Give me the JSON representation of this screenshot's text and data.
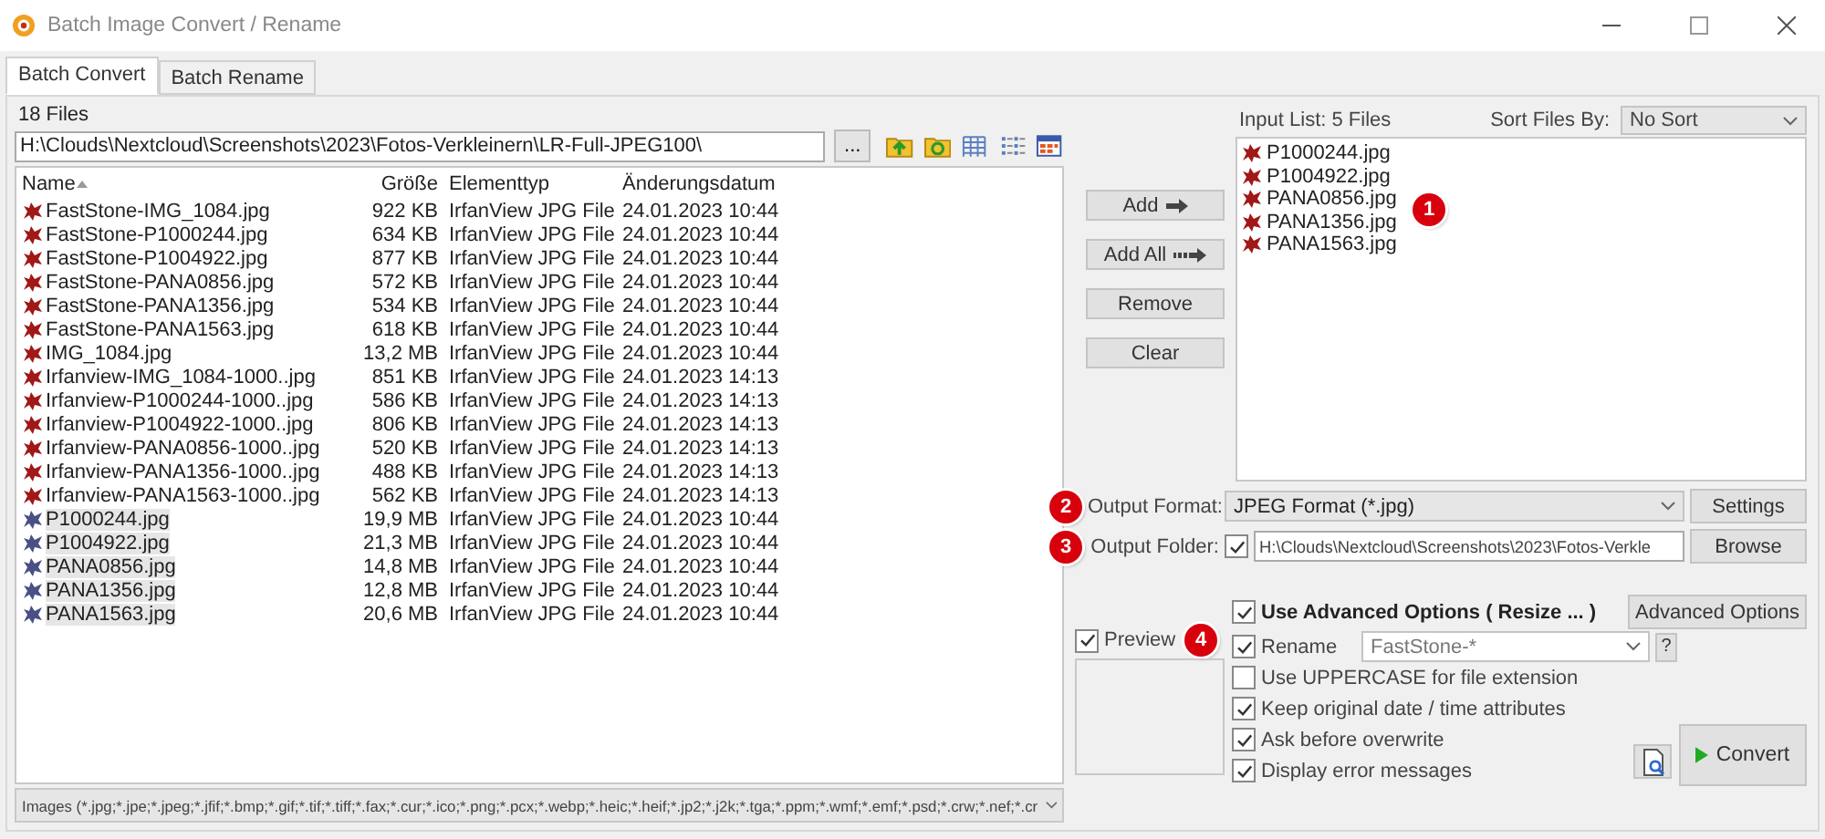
{
  "window": {
    "title": "Batch Image Convert / Rename"
  },
  "tabs": [
    {
      "label": "Batch Convert",
      "selected": true
    },
    {
      "label": "Batch Rename",
      "selected": false
    }
  ],
  "file_count": "18 Files",
  "path": {
    "value": "H:\\Clouds\\Nextcloud\\Screenshots\\2023\\Fotos-Verkleinern\\LR-Full-JPEG100\\",
    "browse": "..."
  },
  "table": {
    "columns": [
      "Name",
      "Größe",
      "Elementtyp",
      "Änderungsdatum"
    ],
    "rows": [
      {
        "name": "FastStone-IMG_1084.jpg",
        "size": "922 KB",
        "type": "IrfanView JPG File",
        "date": "24.01.2023 10:44",
        "selected": false
      },
      {
        "name": "FastStone-P1000244.jpg",
        "size": "634 KB",
        "type": "IrfanView JPG File",
        "date": "24.01.2023 10:44",
        "selected": false
      },
      {
        "name": "FastStone-P1004922.jpg",
        "size": "877 KB",
        "type": "IrfanView JPG File",
        "date": "24.01.2023 10:44",
        "selected": false
      },
      {
        "name": "FastStone-PANA0856.jpg",
        "size": "572 KB",
        "type": "IrfanView JPG File",
        "date": "24.01.2023 10:44",
        "selected": false
      },
      {
        "name": "FastStone-PANA1356.jpg",
        "size": "534 KB",
        "type": "IrfanView JPG File",
        "date": "24.01.2023 10:44",
        "selected": false
      },
      {
        "name": "FastStone-PANA1563.jpg",
        "size": "618 KB",
        "type": "IrfanView JPG File",
        "date": "24.01.2023 10:44",
        "selected": false
      },
      {
        "name": "IMG_1084.jpg",
        "size": "13,2 MB",
        "type": "IrfanView JPG File",
        "date": "24.01.2023 10:44",
        "selected": false
      },
      {
        "name": "Irfanview-IMG_1084-1000..jpg",
        "size": "851 KB",
        "type": "IrfanView JPG File",
        "date": "24.01.2023 14:13",
        "selected": false
      },
      {
        "name": "Irfanview-P1000244-1000..jpg",
        "size": "586 KB",
        "type": "IrfanView JPG File",
        "date": "24.01.2023 14:13",
        "selected": false
      },
      {
        "name": "Irfanview-P1004922-1000..jpg",
        "size": "806 KB",
        "type": "IrfanView JPG File",
        "date": "24.01.2023 14:13",
        "selected": false
      },
      {
        "name": "Irfanview-PANA0856-1000..jpg",
        "size": "520 KB",
        "type": "IrfanView JPG File",
        "date": "24.01.2023 14:13",
        "selected": false
      },
      {
        "name": "Irfanview-PANA1356-1000..jpg",
        "size": "488 KB",
        "type": "IrfanView JPG File",
        "date": "24.01.2023 14:13",
        "selected": false
      },
      {
        "name": "Irfanview-PANA1563-1000..jpg",
        "size": "562 KB",
        "type": "IrfanView JPG File",
        "date": "24.01.2023 14:13",
        "selected": false
      },
      {
        "name": "P1000244.jpg",
        "size": "19,9 MB",
        "type": "IrfanView JPG File",
        "date": "24.01.2023 10:44",
        "selected": true
      },
      {
        "name": "P1004922.jpg",
        "size": "21,3 MB",
        "type": "IrfanView JPG File",
        "date": "24.01.2023 10:44",
        "selected": true
      },
      {
        "name": "PANA0856.jpg",
        "size": "14,8 MB",
        "type": "IrfanView JPG File",
        "date": "24.01.2023 10:44",
        "selected": true
      },
      {
        "name": "PANA1356.jpg",
        "size": "12,8 MB",
        "type": "IrfanView JPG File",
        "date": "24.01.2023 10:44",
        "selected": true
      },
      {
        "name": "PANA1563.jpg",
        "size": "20,6 MB",
        "type": "IrfanView JPG File",
        "date": "24.01.2023 10:44",
        "selected": true
      }
    ]
  },
  "filter": "Images (*.jpg;*.jpe;*.jpeg;*.jfif;*.bmp;*.gif;*.tif;*.tiff;*.fax;*.cur;*.ico;*.png;*.pcx;*.webp;*.heic;*.heif;*.jp2;*.j2k;*.tga;*.ppm;*.wmf;*.emf;*.psd;*.crw;*.nef;*.cr",
  "list_buttons": [
    {
      "label": "Add",
      "kind": "add"
    },
    {
      "label": "Add All",
      "kind": "add_all"
    },
    {
      "label": "Remove",
      "kind": "plain"
    },
    {
      "label": "Clear",
      "kind": "plain"
    }
  ],
  "input_list": {
    "label": "Input List:  5 Files",
    "sort_label": "Sort Files By:",
    "sort_value": "No Sort",
    "files": [
      "P1000244.jpg",
      "P1004922.jpg",
      "PANA0856.jpg",
      "PANA1356.jpg",
      "PANA1563.jpg"
    ]
  },
  "output_format": {
    "label": "Output Format:",
    "value": "JPEG Format (*.jpg)",
    "button": "Settings"
  },
  "output_folder": {
    "label": "Output Folder:",
    "checked": true,
    "value": "H:\\Clouds\\Nextcloud\\Screenshots\\2023\\Fotos-Verkle",
    "button": "Browse"
  },
  "preview": {
    "label": "Preview",
    "checked": true
  },
  "advanced": {
    "label": "Use Advanced Options ( Resize ... )",
    "checked": true,
    "button": "Advanced Options"
  },
  "rename": {
    "label": "Rename",
    "checked": true,
    "value": "FastStone-*",
    "help": "?"
  },
  "options": [
    {
      "label": "Use UPPERCASE for file extension",
      "checked": false
    },
    {
      "label": "Keep original date / time attributes",
      "checked": true
    },
    {
      "label": "Ask before overwrite",
      "checked": true
    },
    {
      "label": "Display error messages",
      "checked": true
    }
  ],
  "convert": "Convert",
  "badges": [
    "1",
    "2",
    "3",
    "4"
  ]
}
